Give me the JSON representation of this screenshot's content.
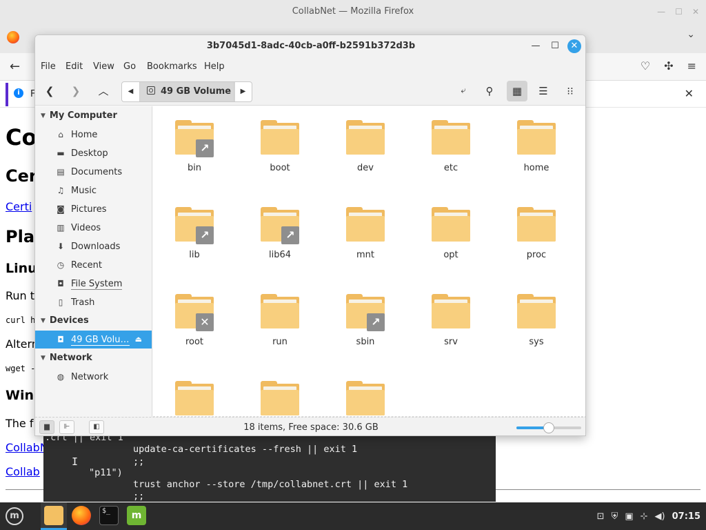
{
  "firefox": {
    "window_title": "CollabNet — Mozilla Firefox",
    "notice_partial": "F",
    "page_fragments": {
      "h1": "Co",
      "cert_heading": "Cer",
      "cert_link": "Certi",
      "platform_heading": "Pla",
      "linux_heading": "Linu",
      "run_text": "Run t",
      "curl_code": "curl h",
      "alt_text": "Altern",
      "wget_code": "wget -",
      "windows_heading": "Win",
      "the_text": "The f",
      "link1": "CollabN",
      "link2": "Collab"
    }
  },
  "terminal": {
    "lines": [
      ".crt || exit 1",
      "update-ca-certificates --fresh || exit 1",
      ";;",
      "\"p11\")",
      "trust anchor --store /tmp/collabnet.crt || exit 1",
      ";;"
    ]
  },
  "file_manager": {
    "window_title": "3b7045d1-8adc-40cb-a0ff-b2591b372d3b",
    "menu": [
      "File",
      "Edit",
      "View",
      "Go",
      "Bookmarks",
      "Help"
    ],
    "current_location": "49 GB Volume",
    "sidebar": {
      "sections": [
        {
          "title": "My Computer",
          "items": [
            {
              "label": "Home",
              "icon": "home-icon"
            },
            {
              "label": "Desktop",
              "icon": "desktop-icon"
            },
            {
              "label": "Documents",
              "icon": "documents-icon"
            },
            {
              "label": "Music",
              "icon": "music-icon"
            },
            {
              "label": "Pictures",
              "icon": "pictures-icon"
            },
            {
              "label": "Videos",
              "icon": "videos-icon"
            },
            {
              "label": "Downloads",
              "icon": "downloads-icon"
            },
            {
              "label": "Recent",
              "icon": "recent-icon"
            },
            {
              "label": "File System",
              "icon": "drive-icon"
            },
            {
              "label": "Trash",
              "icon": "trash-icon"
            }
          ]
        },
        {
          "title": "Devices",
          "items": [
            {
              "label": "49 GB Volu…",
              "icon": "drive-icon",
              "selected": true
            }
          ]
        },
        {
          "title": "Network",
          "items": [
            {
              "label": "Network",
              "icon": "network-icon"
            }
          ]
        }
      ]
    },
    "items": [
      {
        "name": "bin",
        "emblem": "symlink"
      },
      {
        "name": "boot"
      },
      {
        "name": "dev"
      },
      {
        "name": "etc"
      },
      {
        "name": "home"
      },
      {
        "name": "lib",
        "emblem": "symlink"
      },
      {
        "name": "lib64",
        "emblem": "symlink"
      },
      {
        "name": "mnt"
      },
      {
        "name": "opt"
      },
      {
        "name": "proc"
      },
      {
        "name": "root",
        "emblem": "unreadable"
      },
      {
        "name": "run"
      },
      {
        "name": "sbin",
        "emblem": "symlink"
      },
      {
        "name": "srv"
      },
      {
        "name": "sys"
      },
      {
        "name": ""
      },
      {
        "name": ""
      },
      {
        "name": ""
      }
    ],
    "status_text": "18 items, Free space: 30.6 GB",
    "zoom_level": 0.5
  },
  "taskbar": {
    "clock": "07:15"
  },
  "colors": {
    "accent": "#35a1e8",
    "folder": "#f8cf7e",
    "emblem": "#8e8e8e"
  }
}
